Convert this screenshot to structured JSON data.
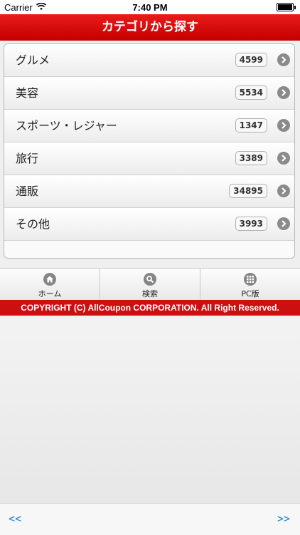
{
  "status_bar": {
    "carrier": "Carrier",
    "time": "7:40 PM"
  },
  "header": {
    "title": "カテゴリから探す"
  },
  "categories": [
    {
      "label": "グルメ",
      "count": "4599"
    },
    {
      "label": "美容",
      "count": "5534"
    },
    {
      "label": "スポーツ・レジャー",
      "count": "1347"
    },
    {
      "label": "旅行",
      "count": "3389"
    },
    {
      "label": "通販",
      "count": "34895"
    },
    {
      "label": "その他",
      "count": "3993"
    }
  ],
  "tabbar": {
    "home_label": "ホーム",
    "search_label": "検索",
    "pc_label": "PC版"
  },
  "footer": {
    "copyright": "COPYRIGHT (C) AllCoupon CORPORATION. All Right Reserved."
  },
  "browser_nav": {
    "back_label": "<<",
    "forward_label": ">>"
  },
  "colors": {
    "brand_red": "#cc1010",
    "link_blue": "#1a7fe0"
  }
}
